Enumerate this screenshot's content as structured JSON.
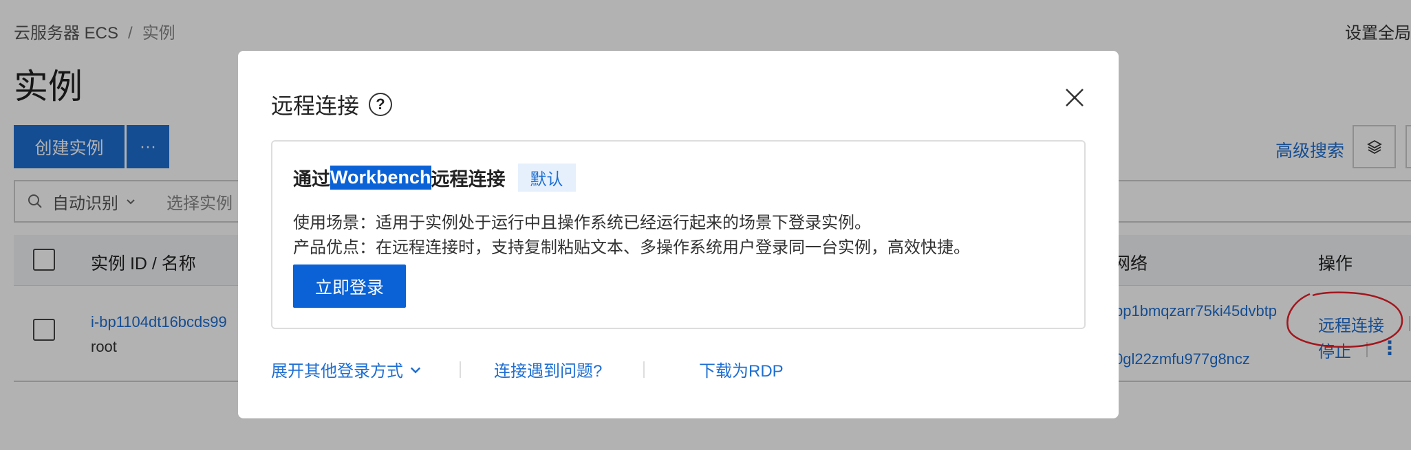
{
  "breadcrumb": {
    "root": "云服务器 ECS",
    "sep": "/",
    "current": "实例"
  },
  "top_right": "设置全局",
  "page_title": "实例",
  "toolbar": {
    "create_label": "创建实例",
    "more_label": "···",
    "advanced_search": "高级搜索"
  },
  "search": {
    "mode": "自动识别",
    "placeholder": "选择实例"
  },
  "table": {
    "headers": {
      "id_name": "实例 ID / 名称",
      "network": "网络",
      "actions": "操作"
    },
    "row": {
      "id": "i-bp1104dt16bcds99",
      "name": "root",
      "network_1": "bp1bmqzarr75ki45dvbtp",
      "network_2": "0gl22zmfu977g8ncz",
      "action_connect": "远程连接",
      "action_stop": "停止"
    }
  },
  "modal": {
    "title": "远程连接",
    "card": {
      "title_prefix": "通过",
      "title_highlight": "Workbench",
      "title_suffix": "远程连接",
      "badge": "默认",
      "line1": "使用场景：适用于实例处于运行中且操作系统已经运行起来的场景下登录实例。",
      "line2": "产品优点：在远程连接时，支持复制粘贴文本、多操作系统用户登录同一台实例，高效快捷。",
      "login_button": "立即登录"
    },
    "footer": {
      "expand_other": "展开其他登录方式",
      "trouble": "连接遇到问题?",
      "download_rdp": "下载为RDP"
    }
  },
  "colors": {
    "primary": "#1f6fd1",
    "annotation": "#e8202a"
  }
}
